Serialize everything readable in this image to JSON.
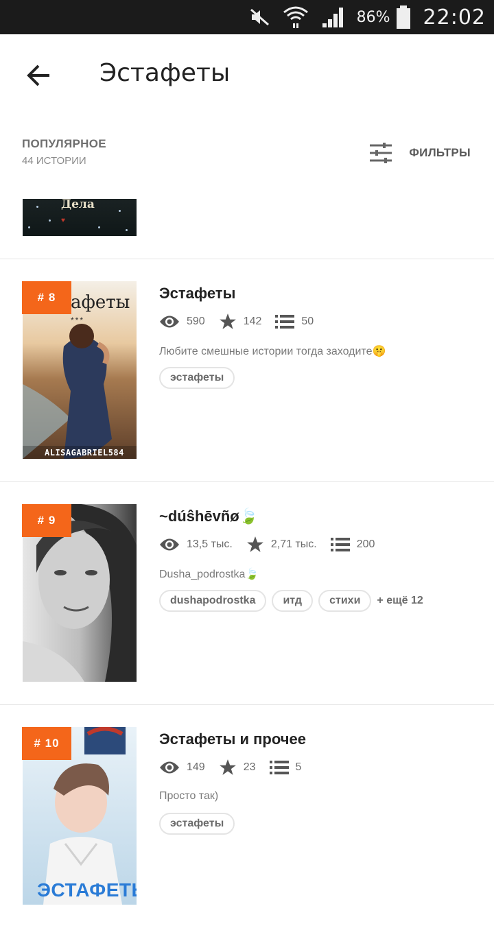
{
  "status_bar": {
    "battery": "86%",
    "time": "22:02"
  },
  "header": {
    "title": "Эстафеты"
  },
  "section": {
    "title": "ПОПУЛЯРНОЕ",
    "count": "44 ИСТОРИИ",
    "filters_label": "ФИЛЬТРЫ"
  },
  "partial_cover": {
    "text": "Дела"
  },
  "stories": [
    {
      "rank": "# 8",
      "cover_text": "афеты",
      "cover_stars": "***",
      "cover_author": "ALISAGABRIEL584",
      "title": "Эстафеты",
      "views": "590",
      "votes": "142",
      "parts": "50",
      "description": "Любите смешные истории тогда заходите🤫",
      "tags": [
        "эстафеты"
      ],
      "more_tags": ""
    },
    {
      "rank": "# 9",
      "title": "~dúŝhēvñø🍃",
      "views": "13,5 тыс.",
      "votes": "2,71 тыс.",
      "parts": "200",
      "description": "Dusha_podrostka🍃",
      "tags": [
        "dushapodrostka",
        "итд",
        "стихи"
      ],
      "more_tags": "+ ещё 12"
    },
    {
      "rank": "# 10",
      "cover_text": "ЭСТАФЕТЫ",
      "title": "Эстафеты и прочее",
      "views": "149",
      "votes": "23",
      "parts": "5",
      "description": "Просто так)",
      "tags": [
        "эстафеты"
      ],
      "more_tags": ""
    }
  ],
  "colors": {
    "rank_badge": "#f4661a",
    "status_bar": "#1b1b1b"
  }
}
